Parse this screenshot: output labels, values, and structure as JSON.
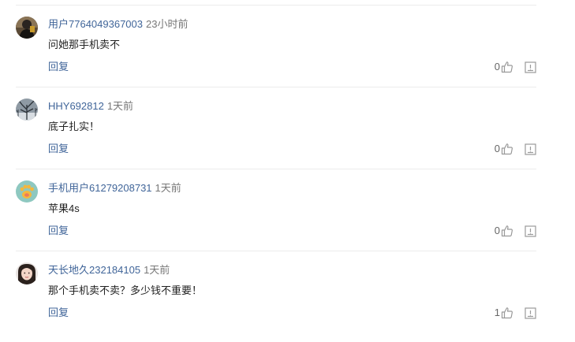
{
  "comments": [
    {
      "username": "用户7764049367003",
      "time": "23小时前",
      "content": "问她那手机卖不",
      "reply_label": "回复",
      "likes": "0",
      "avatar": "dark-figure-avatar",
      "like_icon": "thumbs-up-icon",
      "report_icon": "report-icon"
    },
    {
      "username": "HHY692812",
      "time": "1天前",
      "content": "底子扎实！",
      "reply_label": "回复",
      "likes": "0",
      "avatar": "winter-tree-avatar",
      "like_icon": "thumbs-up-icon",
      "report_icon": "report-icon"
    },
    {
      "username": "手机用户61279208731",
      "time": "1天前",
      "content": "苹果4s",
      "reply_label": "回复",
      "likes": "0",
      "avatar": "paw-default-avatar",
      "like_icon": "thumbs-up-icon",
      "report_icon": "report-icon"
    },
    {
      "username": "天长地久232184105",
      "time": "1天前",
      "content": "那个手机卖不卖？多少钱不重要！",
      "reply_label": "回复",
      "likes": "1",
      "avatar": "woman-portrait-avatar",
      "like_icon": "thumbs-up-icon",
      "report_icon": "report-icon"
    }
  ],
  "colors": {
    "username": "#406599",
    "text": "#222222",
    "muted": "#777777",
    "divider": "#ebebeb",
    "icon": "#999999"
  }
}
